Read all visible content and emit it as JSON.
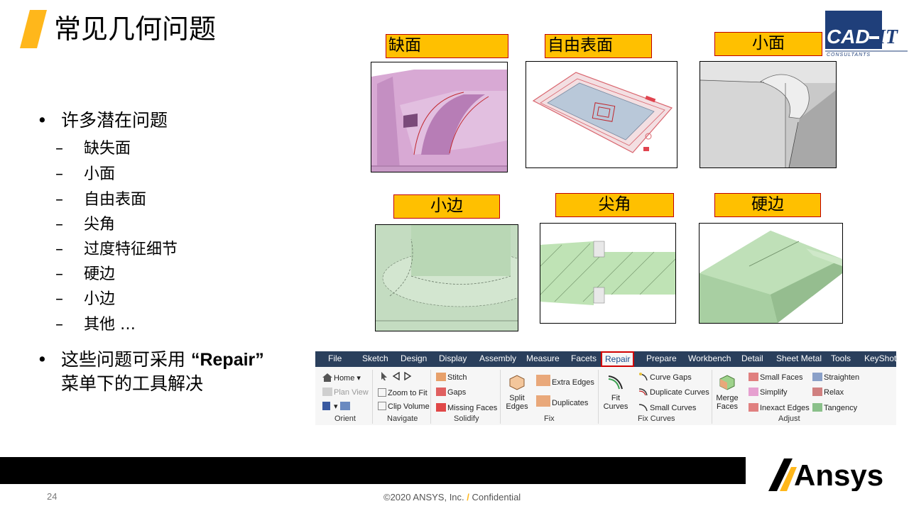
{
  "slide": {
    "title": "常见几何问题",
    "page_number": "24",
    "footer_copyright": "©2020 ANSYS, Inc.",
    "footer_slash": "/",
    "footer_confidential": "Confidential",
    "accent_color": "#ffb71b"
  },
  "logo": {
    "text": "CAD-IT",
    "subtitle": "CONSULTANTS"
  },
  "brand": {
    "text": "Ansys"
  },
  "bullets": {
    "main1": "许多潜在问题",
    "subs": [
      "缺失面",
      "小面",
      "自由表面",
      "尖角",
      "过度特征细节",
      "硬边",
      "小边",
      "其他 …"
    ],
    "main2_line1_pre": "这些问题可采用",
    "main2_quote": "“Repair”",
    "main2_line2": "菜单下的工具解决"
  },
  "images": {
    "missing_face": "缺面",
    "free_surface": "自由表面",
    "small_face": "小面",
    "small_edge": "小边",
    "sharp_angle": "尖角",
    "hard_edge": "硬边"
  },
  "ribbon": {
    "menu": [
      "File",
      "Sketch",
      "Design",
      "Display",
      "Assembly",
      "Measure",
      "Facets",
      "Repair",
      "Prepare",
      "Workbench",
      "Detail",
      "Sheet Metal",
      "Tools",
      "KeyShot"
    ],
    "orient": {
      "home": "Home",
      "plan_view": "Plan View",
      "group": "Orient"
    },
    "navigate": {
      "zoom_to_fit": "Zoom to Fit",
      "clip_volume": "Clip Volume",
      "group": "Navigate"
    },
    "solidify": {
      "stitch": "Stitch",
      "gaps": "Gaps",
      "missing_faces": "Missing Faces",
      "group": "Solidify"
    },
    "fix": {
      "split": "Split",
      "edges": "Edges",
      "extra_edges": "Extra Edges",
      "duplicates": "Duplicates",
      "group": "Fix"
    },
    "fix_curves": {
      "fit": "Fit",
      "curves": "Curves",
      "curve_gaps": "Curve Gaps",
      "duplicate_curves": "Duplicate Curves",
      "small_curves": "Small Curves",
      "group": "Fix Curves"
    },
    "adjust": {
      "merge": "Merge",
      "faces": "Faces",
      "small_faces": "Small Faces",
      "simplify": "Simplify",
      "inexact_edges": "Inexact Edges",
      "straighten": "Straighten",
      "relax": "Relax",
      "tangency": "Tangency",
      "group": "Adjust"
    }
  }
}
